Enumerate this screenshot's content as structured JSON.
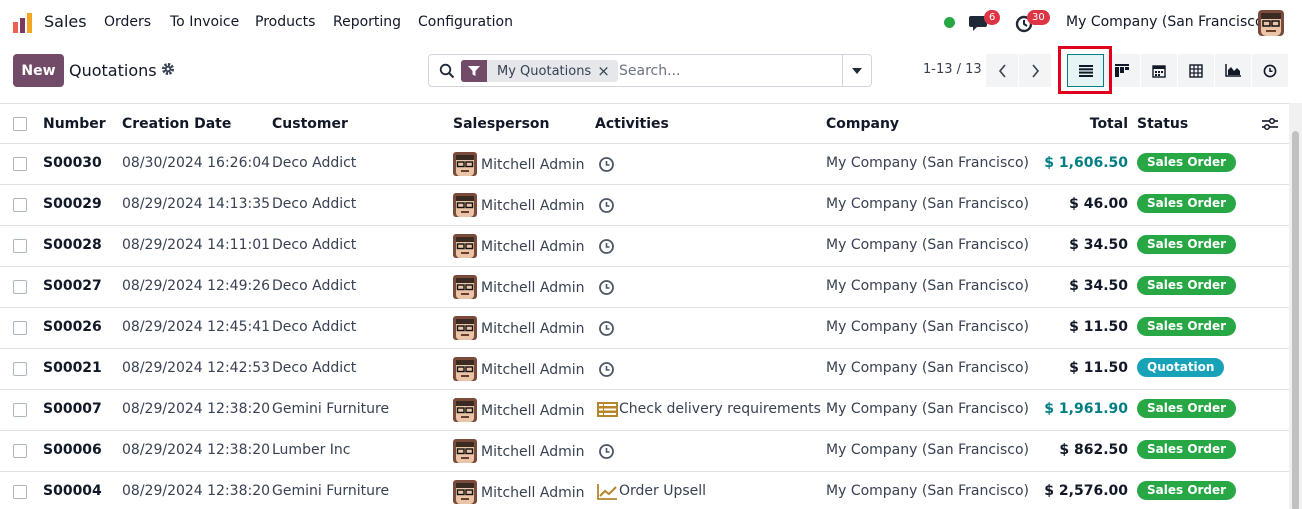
{
  "topnav": {
    "app_name": "Sales",
    "menu": [
      "Orders",
      "To Invoice",
      "Products",
      "Reporting",
      "Configuration"
    ],
    "messages_count": "6",
    "activities_count": "30",
    "company": "My Company (San Francisco)"
  },
  "control": {
    "new_label": "New",
    "title": "Quotations",
    "facet_label": "My Quotations",
    "facet_close": "×",
    "search_placeholder": "Search...",
    "pager": "1-13 / 13"
  },
  "columns": {
    "number": "Number",
    "creation_date": "Creation Date",
    "customer": "Customer",
    "salesperson": "Salesperson",
    "activities": "Activities",
    "company": "Company",
    "total": "Total",
    "status": "Status"
  },
  "rows": [
    {
      "number": "S00030",
      "date": "08/30/2024 16:26:04",
      "customer": "Deco Addict",
      "salesperson": "Mitchell Admin",
      "activity": "",
      "activity_icon": "clock-icon",
      "company": "My Company (San Francisco)",
      "total": "$ 1,606.50",
      "total_link": true,
      "status": "Sales Order",
      "status_color": "#28a745"
    },
    {
      "number": "S00029",
      "date": "08/29/2024 14:13:35",
      "customer": "Deco Addict",
      "salesperson": "Mitchell Admin",
      "activity": "",
      "activity_icon": "clock-icon",
      "company": "My Company (San Francisco)",
      "total": "$ 46.00",
      "total_link": false,
      "status": "Sales Order",
      "status_color": "#28a745"
    },
    {
      "number": "S00028",
      "date": "08/29/2024 14:11:01",
      "customer": "Deco Addict",
      "salesperson": "Mitchell Admin",
      "activity": "",
      "activity_icon": "clock-icon",
      "company": "My Company (San Francisco)",
      "total": "$ 34.50",
      "total_link": false,
      "status": "Sales Order",
      "status_color": "#28a745"
    },
    {
      "number": "S00027",
      "date": "08/29/2024 12:49:26",
      "customer": "Deco Addict",
      "salesperson": "Mitchell Admin",
      "activity": "",
      "activity_icon": "clock-icon",
      "company": "My Company (San Francisco)",
      "total": "$ 34.50",
      "total_link": false,
      "status": "Sales Order",
      "status_color": "#28a745"
    },
    {
      "number": "S00026",
      "date": "08/29/2024 12:45:41",
      "customer": "Deco Addict",
      "salesperson": "Mitchell Admin",
      "activity": "",
      "activity_icon": "clock-icon",
      "company": "My Company (San Francisco)",
      "total": "$ 11.50",
      "total_link": false,
      "status": "Sales Order",
      "status_color": "#28a745"
    },
    {
      "number": "S00021",
      "date": "08/29/2024 12:42:53",
      "customer": "Deco Addict",
      "salesperson": "Mitchell Admin",
      "activity": "",
      "activity_icon": "clock-icon",
      "company": "My Company (San Francisco)",
      "total": "$ 11.50",
      "total_link": false,
      "status": "Quotation",
      "status_color": "#17a2b8"
    },
    {
      "number": "S00007",
      "date": "08/29/2024 12:38:20",
      "customer": "Gemini Furniture",
      "salesperson": "Mitchell Admin",
      "activity": "Check delivery requirements",
      "activity_icon": "list-todo-icon",
      "company": "My Company (San Francisco)",
      "total": "$ 1,961.90",
      "total_link": true,
      "status": "Sales Order",
      "status_color": "#28a745"
    },
    {
      "number": "S00006",
      "date": "08/29/2024 12:38:20",
      "customer": "Lumber Inc",
      "salesperson": "Mitchell Admin",
      "activity": "",
      "activity_icon": "clock-icon",
      "company": "My Company (San Francisco)",
      "total": "$ 862.50",
      "total_link": false,
      "status": "Sales Order",
      "status_color": "#28a745"
    },
    {
      "number": "S00004",
      "date": "08/29/2024 12:38:20",
      "customer": "Gemini Furniture",
      "salesperson": "Mitchell Admin",
      "activity": "Order Upsell",
      "activity_icon": "trend-up-icon",
      "company": "My Company (San Francisco)",
      "total": "$ 2,576.00",
      "total_link": false,
      "status": "Sales Order",
      "status_color": "#28a745"
    }
  ],
  "colors": {
    "brand": "#714b67",
    "accent": "#017e84",
    "highlight": "#e0001b"
  }
}
